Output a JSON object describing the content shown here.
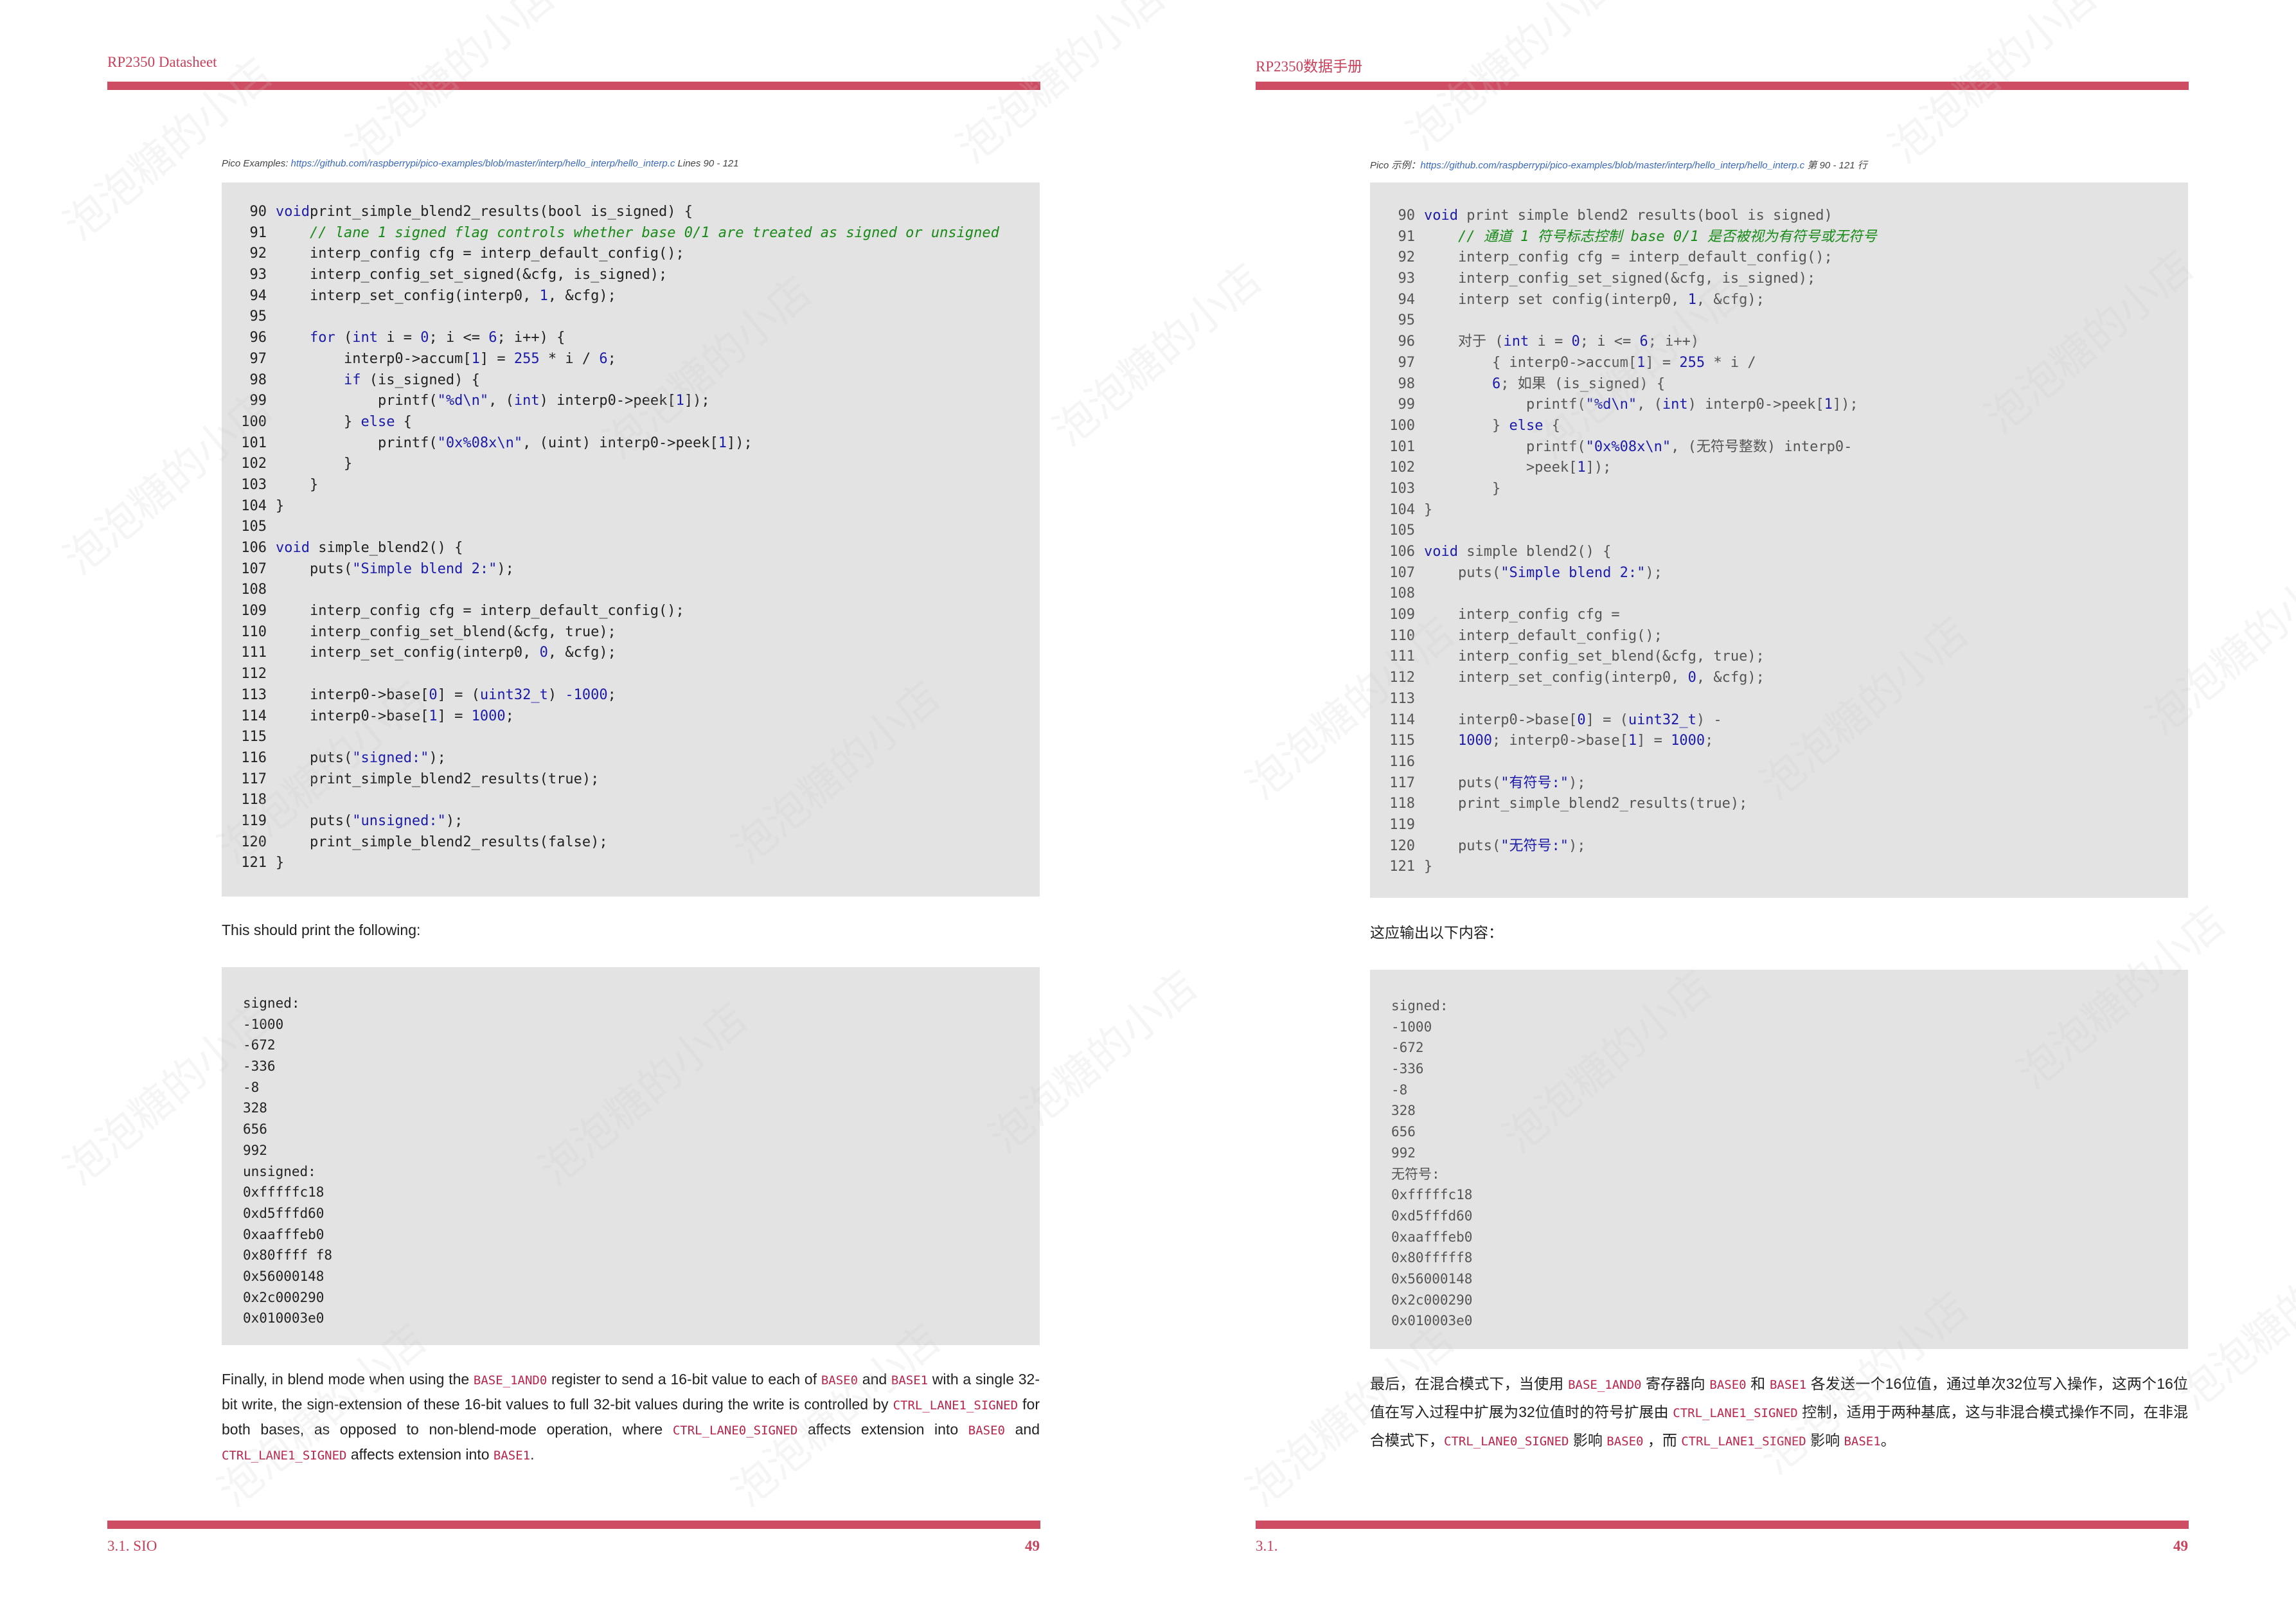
{
  "left": {
    "header": "RP2350 Datasheet",
    "caption_prefix": "Pico Examples: ",
    "caption_link": "https://github.com/raspberrypi/pico-examples/blob/master/interp/hello_interp/hello_interp.c",
    "caption_suffix": " Lines 90 - 121",
    "code": [
      {
        "n": "90",
        "t": [
          [
            "kw",
            "void"
          ],
          [
            "",
            "print_simple_blend2_results(bool is_signed) {"
          ]
        ]
      },
      {
        "n": "91",
        "t": [
          [
            "",
            "    "
          ],
          [
            "cm",
            "// lane 1 signed flag controls whether base 0/1 are treated as signed or unsigned"
          ]
        ]
      },
      {
        "n": "92",
        "t": [
          [
            "",
            "    interp_config cfg = interp_default_config();"
          ]
        ]
      },
      {
        "n": "93",
        "t": [
          [
            "",
            "    interp_config_set_signed(&cfg, is_signed);"
          ]
        ]
      },
      {
        "n": "94",
        "t": [
          [
            "",
            "    interp_set_config(interp0, "
          ],
          [
            "num",
            "1"
          ],
          [
            "",
            ", &cfg);"
          ]
        ]
      },
      {
        "n": "95",
        "t": [
          [
            "",
            ""
          ]
        ]
      },
      {
        "n": "96",
        "t": [
          [
            "",
            "    "
          ],
          [
            "kw",
            "for"
          ],
          [
            "",
            " ("
          ],
          [
            "kw",
            "int"
          ],
          [
            "",
            " i = "
          ],
          [
            "num",
            "0"
          ],
          [
            "",
            "; i <= "
          ],
          [
            "num",
            "6"
          ],
          [
            "",
            "; i++) {"
          ]
        ]
      },
      {
        "n": "97",
        "t": [
          [
            "",
            "        interp0->accum["
          ],
          [
            "num",
            "1"
          ],
          [
            "",
            "] = "
          ],
          [
            "num",
            "255"
          ],
          [
            "",
            " * i / "
          ],
          [
            "num",
            "6"
          ],
          [
            "",
            ";"
          ]
        ]
      },
      {
        "n": "98",
        "t": [
          [
            "",
            "        "
          ],
          [
            "kw",
            "if"
          ],
          [
            "",
            " (is_signed) {"
          ]
        ]
      },
      {
        "n": "99",
        "t": [
          [
            "",
            "            printf("
          ],
          [
            "str",
            "\"%d\\n\""
          ],
          [
            "",
            ", ("
          ],
          [
            "kw",
            "int"
          ],
          [
            "",
            ") interp0->peek["
          ],
          [
            "num",
            "1"
          ],
          [
            "",
            "]);"
          ]
        ]
      },
      {
        "n": "100",
        "t": [
          [
            "",
            "        } "
          ],
          [
            "kw",
            "else"
          ],
          [
            "",
            " {"
          ]
        ]
      },
      {
        "n": "101",
        "t": [
          [
            "",
            "            printf("
          ],
          [
            "str",
            "\"0x%08x\\n\""
          ],
          [
            "",
            ", (uint) interp0->peek["
          ],
          [
            "num",
            "1"
          ],
          [
            "",
            "]);"
          ]
        ]
      },
      {
        "n": "102",
        "t": [
          [
            "",
            "        }"
          ]
        ]
      },
      {
        "n": "103",
        "t": [
          [
            "",
            "    }"
          ]
        ]
      },
      {
        "n": "104",
        "t": [
          [
            "",
            "}"
          ]
        ]
      },
      {
        "n": "105",
        "t": [
          [
            "",
            ""
          ]
        ]
      },
      {
        "n": "106",
        "t": [
          [
            "kw",
            "void"
          ],
          [
            "",
            " simple_blend2() {"
          ]
        ]
      },
      {
        "n": "107",
        "t": [
          [
            "",
            "    puts("
          ],
          [
            "str",
            "\"Simple blend 2:\""
          ],
          [
            "",
            ");"
          ]
        ]
      },
      {
        "n": "108",
        "t": [
          [
            "",
            ""
          ]
        ]
      },
      {
        "n": "109",
        "t": [
          [
            "",
            "    interp_config cfg = interp_default_config();"
          ]
        ]
      },
      {
        "n": "110",
        "t": [
          [
            "",
            "    interp_config_set_blend(&cfg, true);"
          ]
        ]
      },
      {
        "n": "111",
        "t": [
          [
            "",
            "    interp_set_config(interp0, "
          ],
          [
            "num",
            "0"
          ],
          [
            "",
            ", &cfg);"
          ]
        ]
      },
      {
        "n": "112",
        "t": [
          [
            "",
            ""
          ]
        ]
      },
      {
        "n": "113",
        "t": [
          [
            "",
            "    interp0->base["
          ],
          [
            "num",
            "0"
          ],
          [
            "",
            "] = ("
          ],
          [
            "kw",
            "uint32_t"
          ],
          [
            "",
            ") "
          ],
          [
            "num",
            "-1000"
          ],
          [
            "",
            ";"
          ]
        ]
      },
      {
        "n": "114",
        "t": [
          [
            "",
            "    interp0->base["
          ],
          [
            "num",
            "1"
          ],
          [
            "",
            "] = "
          ],
          [
            "num",
            "1000"
          ],
          [
            "",
            ";"
          ]
        ]
      },
      {
        "n": "115",
        "t": [
          [
            "",
            ""
          ]
        ]
      },
      {
        "n": "116",
        "t": [
          [
            "",
            "    puts("
          ],
          [
            "str",
            "\"signed:\""
          ],
          [
            "",
            ");"
          ]
        ]
      },
      {
        "n": "117",
        "t": [
          [
            "",
            "    print_simple_blend2_results(true);"
          ]
        ]
      },
      {
        "n": "118",
        "t": [
          [
            "",
            ""
          ]
        ]
      },
      {
        "n": "119",
        "t": [
          [
            "",
            "    puts("
          ],
          [
            "str",
            "\"unsigned:\""
          ],
          [
            "",
            ");"
          ]
        ]
      },
      {
        "n": "120",
        "t": [
          [
            "",
            "    print_simple_blend2_results(false);"
          ]
        ]
      },
      {
        "n": "121",
        "t": [
          [
            "",
            "}"
          ]
        ]
      }
    ],
    "intro": "This should print the following:",
    "output": [
      "signed:",
      "-1000",
      "-672",
      "-336",
      "-8",
      "328",
      "656",
      "992",
      "unsigned:",
      "0xfffffc18",
      "0xd5fffd60",
      "0xaafffeb0",
      "0x80ffff f8",
      "0x56000148",
      "0x2c000290",
      "0x010003e0"
    ],
    "final_parts": [
      [
        "",
        "Finally, in blend mode when using the "
      ],
      [
        "code",
        "BASE_1AND0"
      ],
      [
        "",
        " register to send a 16-bit value to each of "
      ],
      [
        "code",
        "BASE0"
      ],
      [
        "",
        " and "
      ],
      [
        "code",
        "BASE1"
      ],
      [
        "",
        " with a single 32-bit write, the sign-extension of these 16-bit values to full 32-bit values during the write is controlled by "
      ],
      [
        "code",
        "CTRL_LANE1_SIGNED"
      ],
      [
        "",
        " for both bases, as opposed to non-blend-mode operation, where "
      ],
      [
        "code",
        "CTRL_LANE0_SIGNED"
      ],
      [
        "",
        " affects extension into "
      ],
      [
        "code",
        "BASE0"
      ],
      [
        "",
        " and "
      ],
      [
        "code",
        "CTRL_LANE1_SIGNED"
      ],
      [
        "",
        " affects extension into "
      ],
      [
        "code",
        "BASE1"
      ],
      [
        "",
        "."
      ]
    ],
    "footer_section": "3.1. SIO",
    "footer_page": "49"
  },
  "right": {
    "header": "RP2350数据手册",
    "caption_prefix": "Pico 示例：",
    "caption_link": "https://github.com/raspberrypi/pico-examples/blob/master/interp/hello_interp/hello_interp.c",
    "caption_suffix": " 第 90 - 121 行",
    "code": [
      {
        "n": "90",
        "t": [
          [
            "kw",
            "void"
          ],
          [
            "",
            " print simple blend2 results(bool is signed)"
          ]
        ]
      },
      {
        "n": "91",
        "t": [
          [
            "",
            "    "
          ],
          [
            "cm",
            "// 通道 1 符号标志控制 base 0/1 是否被视为有符号或无符号"
          ]
        ]
      },
      {
        "n": "92",
        "t": [
          [
            "",
            "    interp_config cfg = interp_default_config();"
          ]
        ]
      },
      {
        "n": "93",
        "t": [
          [
            "",
            "    interp_config_set_signed(&cfg, is_signed);"
          ]
        ]
      },
      {
        "n": "94",
        "t": [
          [
            "",
            "    interp set config(interp0, "
          ],
          [
            "num",
            "1"
          ],
          [
            "",
            ", &cfg);"
          ]
        ]
      },
      {
        "n": "95",
        "t": [
          [
            "",
            ""
          ]
        ]
      },
      {
        "n": "96",
        "t": [
          [
            "",
            "    对于 ("
          ],
          [
            "kw",
            "int"
          ],
          [
            "",
            " i = "
          ],
          [
            "num",
            "0"
          ],
          [
            "",
            "; i <= "
          ],
          [
            "num",
            "6"
          ],
          [
            "",
            "; i++)"
          ]
        ]
      },
      {
        "n": "97",
        "t": [
          [
            "",
            "        { interp0->accum["
          ],
          [
            "num",
            "1"
          ],
          [
            "",
            "] = "
          ],
          [
            "num",
            "255"
          ],
          [
            "",
            " * i /"
          ]
        ]
      },
      {
        "n": "98",
        "t": [
          [
            "",
            "        "
          ],
          [
            "num",
            "6"
          ],
          [
            "",
            "; 如果 (is_signed) {"
          ]
        ]
      },
      {
        "n": "99",
        "t": [
          [
            "",
            "            printf("
          ],
          [
            "str",
            "\"%d\\n\""
          ],
          [
            "",
            ", ("
          ],
          [
            "kw",
            "int"
          ],
          [
            "",
            ") interp0->peek["
          ],
          [
            "num",
            "1"
          ],
          [
            "",
            "]);"
          ]
        ]
      },
      {
        "n": "100",
        "t": [
          [
            "",
            "        } "
          ],
          [
            "kw",
            "else"
          ],
          [
            "",
            " {"
          ]
        ]
      },
      {
        "n": "101",
        "t": [
          [
            "",
            "            printf("
          ],
          [
            "str",
            "\"0x%08x\\n\""
          ],
          [
            "",
            ", (无符号整数) interp0-"
          ]
        ]
      },
      {
        "n": "102",
        "t": [
          [
            "",
            "            >peek["
          ],
          [
            "num",
            "1"
          ],
          [
            "",
            "]);"
          ]
        ]
      },
      {
        "n": "103",
        "t": [
          [
            "",
            "        }"
          ]
        ]
      },
      {
        "n": "104",
        "t": [
          [
            "",
            "}"
          ]
        ]
      },
      {
        "n": "105",
        "t": [
          [
            "",
            ""
          ]
        ]
      },
      {
        "n": "106",
        "t": [
          [
            "kw",
            "void"
          ],
          [
            "",
            " simple blend2() {"
          ]
        ]
      },
      {
        "n": "107",
        "t": [
          [
            "",
            "    puts("
          ],
          [
            "str",
            "\"Simple blend 2:\""
          ],
          [
            "",
            ");"
          ]
        ]
      },
      {
        "n": "108",
        "t": [
          [
            "",
            ""
          ]
        ]
      },
      {
        "n": "109",
        "t": [
          [
            "",
            "    interp_config cfg ="
          ]
        ]
      },
      {
        "n": "110",
        "t": [
          [
            "",
            "    interp_default_config();"
          ]
        ]
      },
      {
        "n": "111",
        "t": [
          [
            "",
            "    interp_config_set_blend(&cfg, true);"
          ]
        ]
      },
      {
        "n": "112",
        "t": [
          [
            "",
            "    interp_set_config(interp0, "
          ],
          [
            "num",
            "0"
          ],
          [
            "",
            ", &cfg);"
          ]
        ]
      },
      {
        "n": "113",
        "t": [
          [
            "",
            ""
          ]
        ]
      },
      {
        "n": "114",
        "t": [
          [
            "",
            "    interp0->base["
          ],
          [
            "num",
            "0"
          ],
          [
            "",
            "] = ("
          ],
          [
            "kw",
            "uint32_t"
          ],
          [
            "",
            ") -"
          ]
        ]
      },
      {
        "n": "115",
        "t": [
          [
            "",
            "    "
          ],
          [
            "num",
            "1000"
          ],
          [
            "",
            "; interp0->base["
          ],
          [
            "num",
            "1"
          ],
          [
            "",
            "] = "
          ],
          [
            "num",
            "1000"
          ],
          [
            "",
            ";"
          ]
        ]
      },
      {
        "n": "116",
        "t": [
          [
            "",
            ""
          ]
        ]
      },
      {
        "n": "117",
        "t": [
          [
            "",
            "    puts("
          ],
          [
            "str",
            "\"有符号:\""
          ],
          [
            "",
            ");"
          ]
        ]
      },
      {
        "n": "118",
        "t": [
          [
            "",
            "    print_simple_blend2_results(true);"
          ]
        ]
      },
      {
        "n": "119",
        "t": [
          [
            "",
            ""
          ]
        ]
      },
      {
        "n": "120",
        "t": [
          [
            "",
            "    puts("
          ],
          [
            "str",
            "\"无符号:\""
          ],
          [
            "",
            ");"
          ]
        ]
      },
      {
        "n": "121",
        "t": [
          [
            "",
            "}"
          ]
        ]
      }
    ],
    "intro": "这应输出以下内容：",
    "output": [
      "signed:",
      "-1000",
      "-672",
      "-336",
      "-8",
      "328",
      "656",
      "992",
      "无符号:",
      "0xfffffc18",
      "0xd5fffd60",
      "0xaafffeb0",
      "0x80fffff8",
      "0x56000148",
      "0x2c000290",
      "0x010003e0"
    ],
    "final_parts": [
      [
        "",
        "最后，在混合模式下，当使用 "
      ],
      [
        "code",
        "BASE_1AND0"
      ],
      [
        "",
        " 寄存器向 "
      ],
      [
        "code",
        "BASE0"
      ],
      [
        "",
        " 和 "
      ],
      [
        "code",
        "BASE1"
      ],
      [
        "",
        " 各发送一个16位值，通过单次32位写入操作，这两个16位值在写入过程中扩展为32位值时的符号扩展由 "
      ],
      [
        "code",
        "CTRL_LANE1_SIGNED"
      ],
      [
        "",
        " 控制，适用于两种基底，这与非混合模式操作不同，在非混合模式下，"
      ],
      [
        "code",
        "CTRL_LANE0_SIGNED"
      ],
      [
        "",
        " 影响 "
      ],
      [
        "code",
        "BASE0"
      ],
      [
        "",
        " ，而 "
      ],
      [
        "code",
        "CTRL_LANE1_SIGNED"
      ],
      [
        "",
        " 影响 "
      ],
      [
        "code",
        "BASE1"
      ],
      [
        "",
        "。"
      ]
    ],
    "footer_section": "3.1.",
    "footer_page": "49"
  },
  "watermark": "泡泡糖的小店"
}
